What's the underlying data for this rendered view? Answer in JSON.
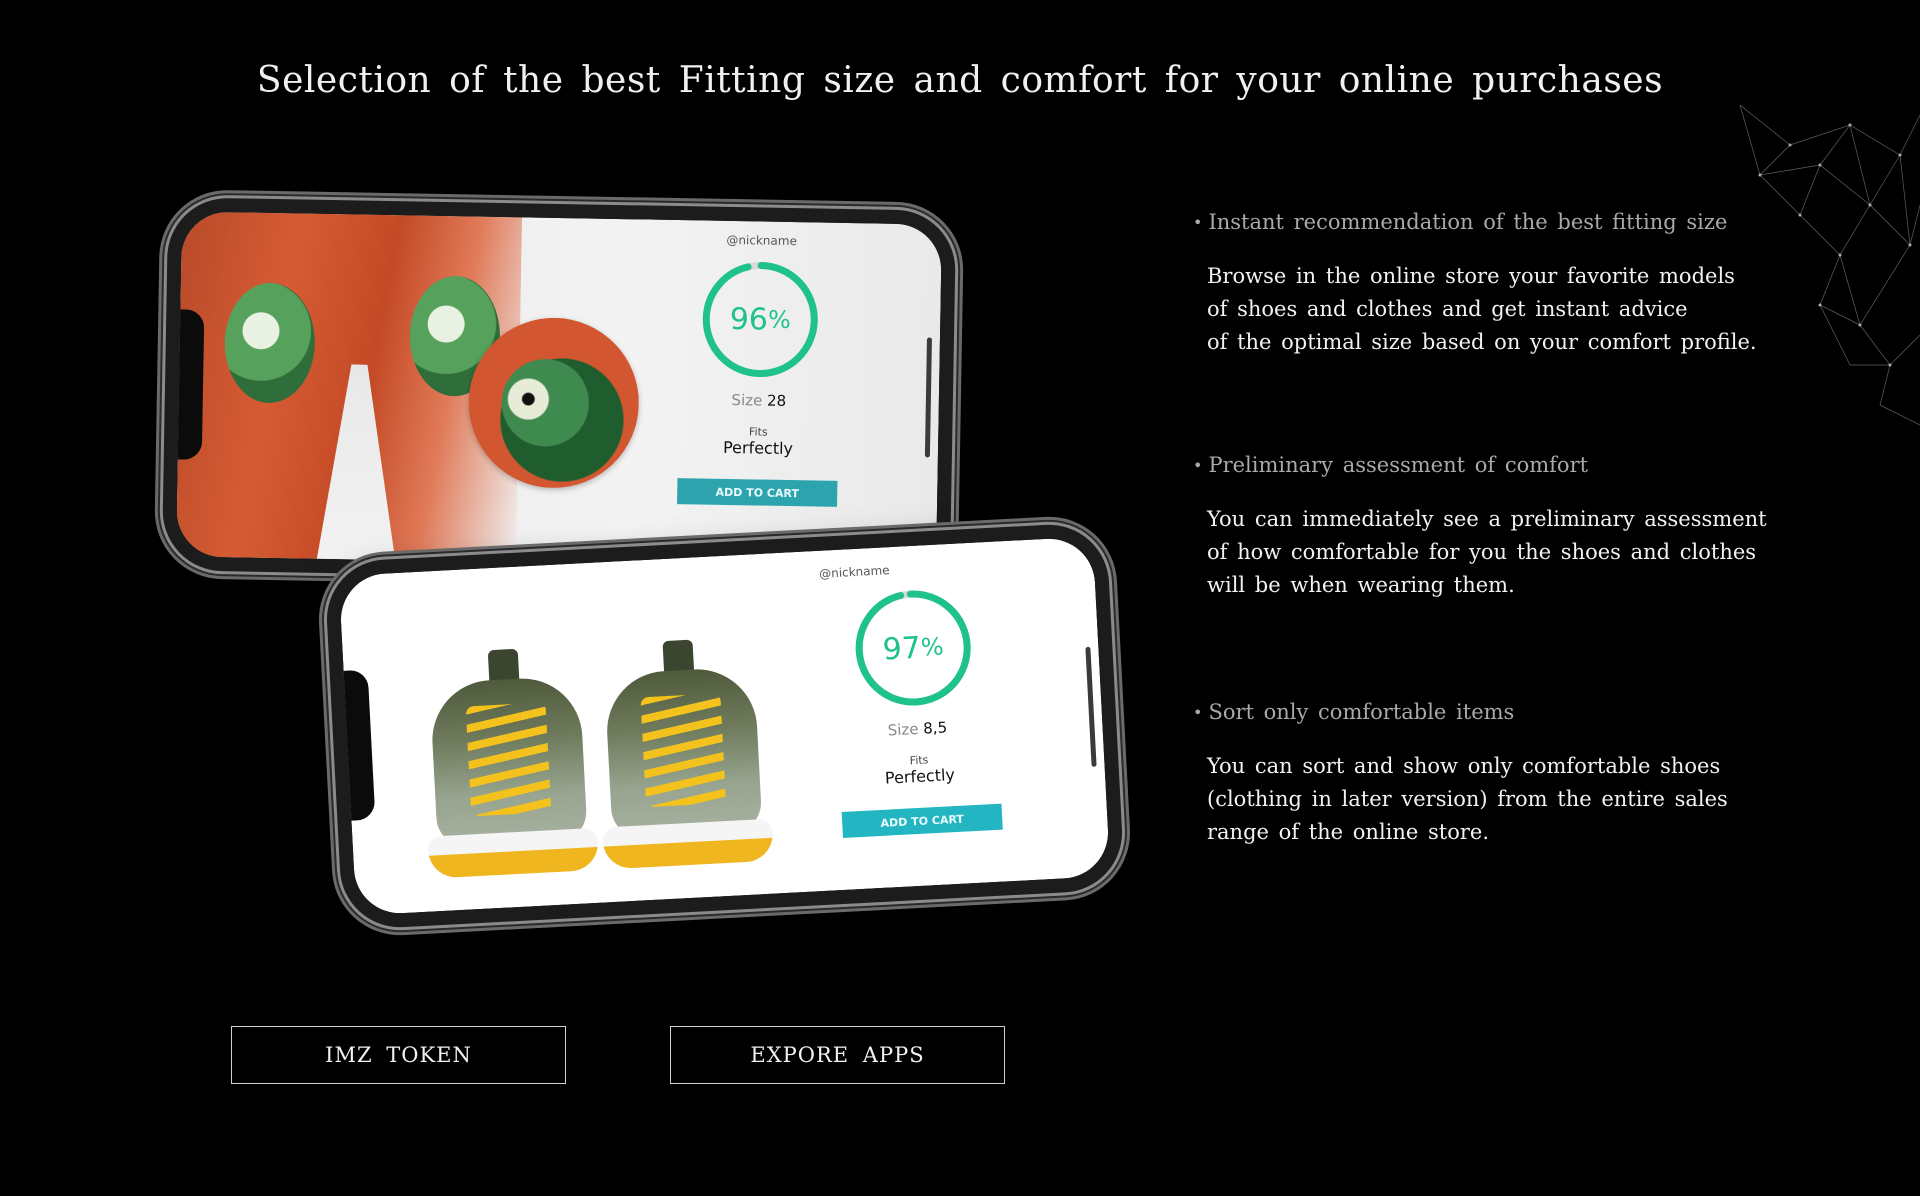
{
  "headline": "Selection of the best Fitting size and comfort for your online purchases",
  "colors": {
    "background": "#000000",
    "accent_green": "#1fc38a",
    "cart_button": "#23b6c2"
  },
  "phones": [
    {
      "nickname": "@nickname",
      "percent": "96",
      "percent_sign": "%",
      "percent_value": 96,
      "size_label": "Size",
      "size_value": "28",
      "fits_label": "Fits",
      "fits_value": "Perfectly",
      "cart_label": "ADD TO CART"
    },
    {
      "nickname": "@nickname",
      "percent": "97",
      "percent_sign": "%",
      "percent_value": 97,
      "size_label": "Size",
      "size_value": "8,5",
      "fits_label": "Fits",
      "fits_value": "Perfectly",
      "cart_label": "ADD TO CART"
    }
  ],
  "features": [
    {
      "title": "Instant recommendation of the best fitting size",
      "body": "Browse in the online store your favorite models\nof shoes and clothes and get instant advice\nof the optimal size based on your comfort profile."
    },
    {
      "title": "Preliminary assessment of comfort",
      "body": "You can immediately see a preliminary assessment\nof how comfortable for you the shoes and clothes\nwill be when wearing them."
    },
    {
      "title": "Sort only comfortable items",
      "body": "You can sort and show only comfortable shoes\n(clothing in later version) from the entire sales\nrange of the online store."
    }
  ],
  "buttons": {
    "token_label": "IMZ TOKEN",
    "apps_label": "EXPORE APPS"
  }
}
